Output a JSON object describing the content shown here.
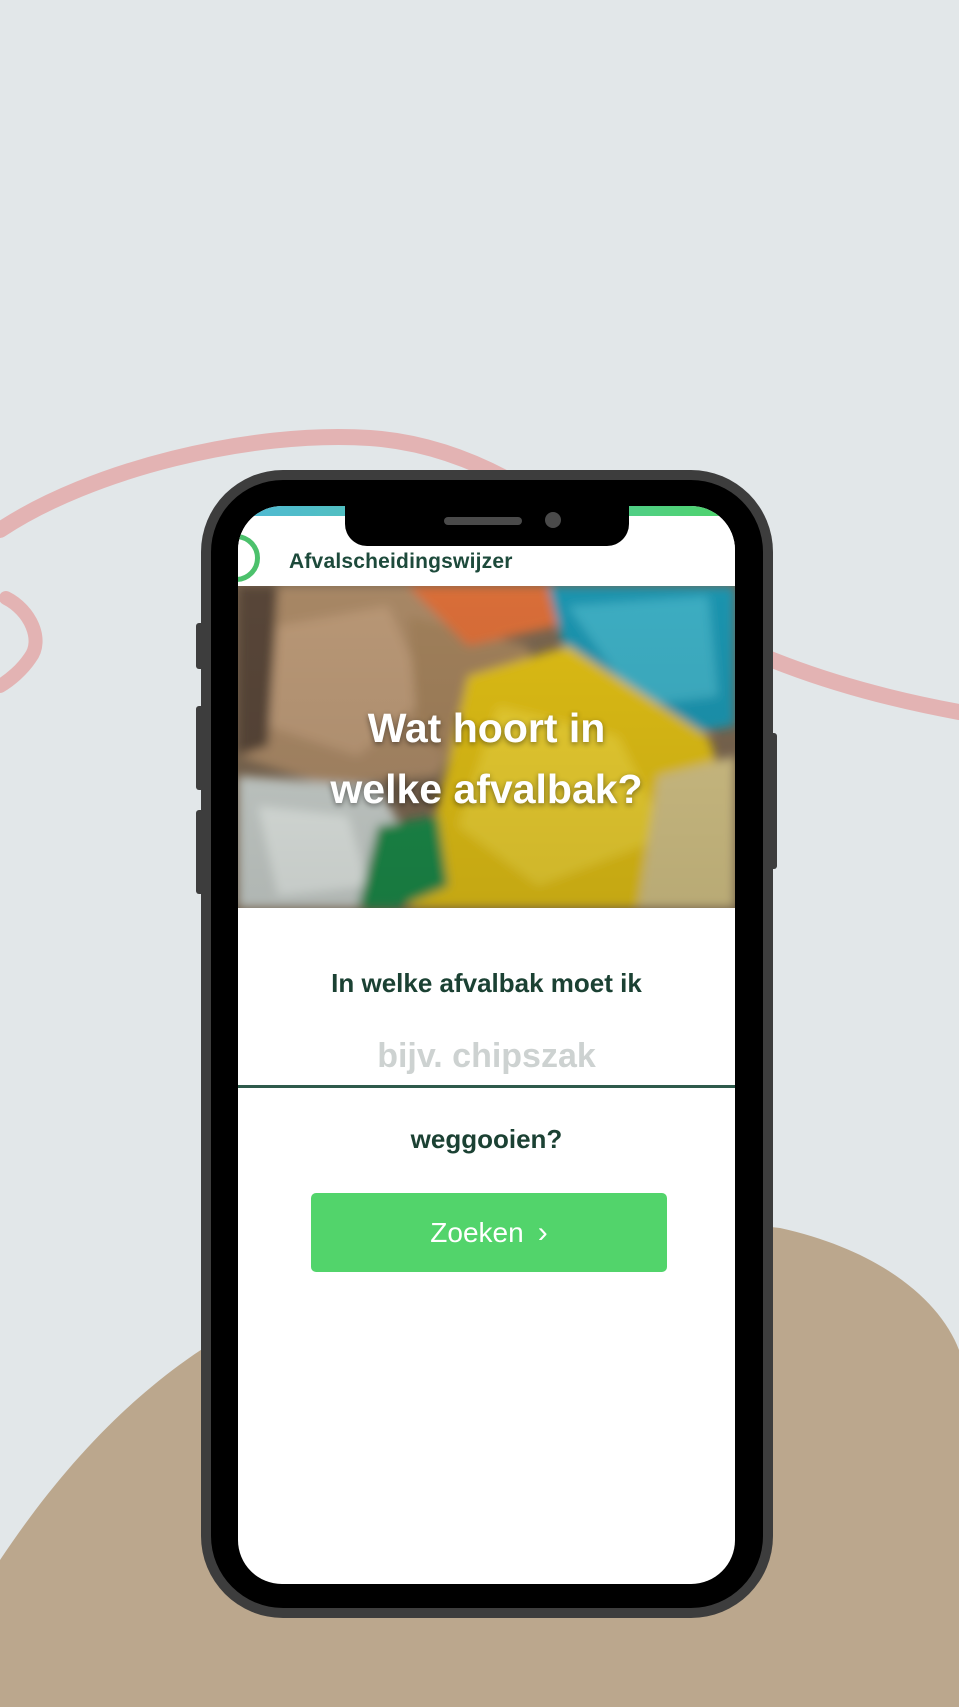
{
  "app": {
    "title": "Afvalscheidingswijzer"
  },
  "hero": {
    "title_line1": "Wat hoort in",
    "title_line2": "welke afvalbak?"
  },
  "search": {
    "question_top": "In welke afvalbak moet ik",
    "placeholder": "bijv. chipszak",
    "value": "",
    "question_bottom": "weggooien?",
    "button_label": "Zoeken",
    "button_icon": "chevron-right-icon"
  },
  "colors": {
    "background": "#e2e7e9",
    "accent_green": "#52d46b",
    "text_dark_green": "#1b4133",
    "decor_pink": "#e3b3b3",
    "decor_tan": "#bba78d",
    "phone_frame": "#3d3d3d"
  }
}
